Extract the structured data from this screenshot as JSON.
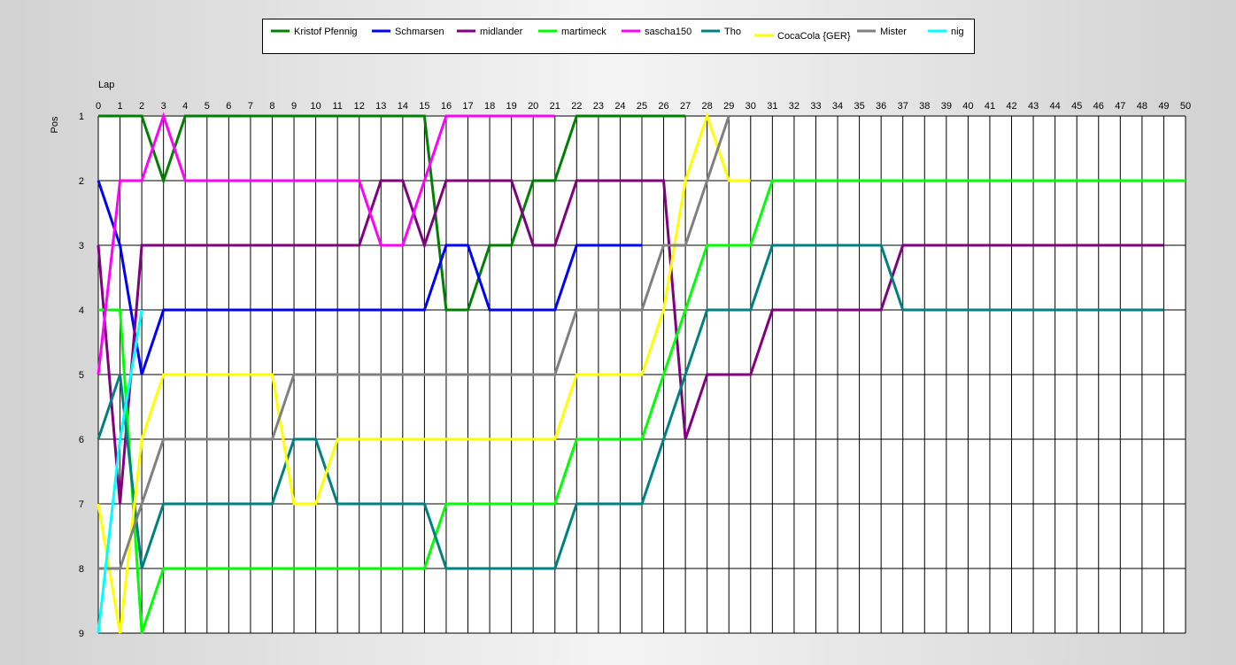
{
  "chart_data": {
    "type": "line",
    "title": "",
    "xlabel": "Lap",
    "ylabel": "Pos",
    "x": [
      0,
      1,
      2,
      3,
      4,
      5,
      6,
      7,
      8,
      9,
      10,
      11,
      12,
      13,
      14,
      15,
      16,
      17,
      18,
      19,
      20,
      21,
      22,
      23,
      24,
      25,
      26,
      27,
      28,
      29,
      30,
      31,
      32,
      33,
      34,
      35,
      36,
      37,
      38,
      39,
      40,
      41,
      42,
      43,
      44,
      45,
      46,
      47,
      48,
      49,
      50
    ],
    "y_ticks": [
      1,
      2,
      3,
      4,
      5,
      6,
      7,
      8,
      9
    ],
    "xlim": [
      0,
      50
    ],
    "ylim": [
      1,
      9
    ],
    "y_inverted": true,
    "grid": true,
    "legend_position": "top-center",
    "series": [
      {
        "name": "Kristof Pfennig",
        "color": "#008000",
        "values": [
          1,
          1,
          1,
          2,
          1,
          1,
          1,
          1,
          1,
          1,
          1,
          1,
          1,
          1,
          1,
          1,
          4,
          4,
          3,
          3,
          2,
          2,
          1,
          1,
          1,
          1,
          1,
          1
        ]
      },
      {
        "name": "Schmarsen",
        "color": "#0000ff",
        "values": [
          2,
          3,
          5,
          4,
          4,
          4,
          4,
          4,
          4,
          4,
          4,
          4,
          4,
          4,
          4,
          4,
          3,
          3,
          4,
          4,
          4,
          4,
          3,
          3,
          3,
          3
        ]
      },
      {
        "name": "midlander",
        "color": "#800080",
        "values": [
          3,
          7,
          3,
          3,
          3,
          3,
          3,
          3,
          3,
          3,
          3,
          3,
          3,
          2,
          2,
          3,
          2,
          2,
          2,
          2,
          3,
          3,
          2,
          2,
          2,
          2,
          2,
          6,
          5,
          5,
          5,
          4,
          4,
          4,
          4,
          4,
          4,
          3,
          3,
          3,
          3,
          3,
          3,
          3,
          3,
          3,
          3,
          3,
          3,
          3
        ]
      },
      {
        "name": "martimeck",
        "color": "#00ff00",
        "values": [
          4,
          4,
          9,
          8,
          8,
          8,
          8,
          8,
          8,
          8,
          8,
          8,
          8,
          8,
          8,
          8,
          7,
          7,
          7,
          7,
          7,
          7,
          6,
          6,
          6,
          6,
          5,
          4,
          3,
          3,
          3,
          2,
          2,
          2,
          2,
          2,
          2,
          2,
          2,
          2,
          2,
          2,
          2,
          2,
          2,
          2,
          2,
          2,
          2,
          2,
          2
        ]
      },
      {
        "name": "sascha150",
        "color": "#ff00ff",
        "values": [
          5,
          2,
          2,
          1,
          2,
          2,
          2,
          2,
          2,
          2,
          2,
          2,
          2,
          3,
          3,
          2,
          1,
          1,
          1,
          1,
          1,
          1
        ]
      },
      {
        "name": "Tho",
        "color": "#008080",
        "values": [
          6,
          5,
          8,
          7,
          7,
          7,
          7,
          7,
          7,
          6,
          6,
          7,
          7,
          7,
          7,
          7,
          8,
          8,
          8,
          8,
          8,
          8,
          7,
          7,
          7,
          7,
          6,
          5,
          4,
          4,
          4,
          3,
          3,
          3,
          3,
          3,
          3,
          4,
          4,
          4,
          4,
          4,
          4,
          4,
          4,
          4,
          4,
          4,
          4,
          4
        ]
      },
      {
        "name": "CocaCola {GER}",
        "color": "#ffff00",
        "values": [
          7,
          9,
          6,
          5,
          5,
          5,
          5,
          5,
          5,
          7,
          7,
          6,
          6,
          6,
          6,
          6,
          6,
          6,
          6,
          6,
          6,
          6,
          5,
          5,
          5,
          5,
          4,
          2,
          1,
          2,
          2
        ]
      },
      {
        "name": "Mister",
        "color": "#808080",
        "values": [
          8,
          8,
          7,
          6,
          6,
          6,
          6,
          6,
          6,
          5,
          5,
          5,
          5,
          5,
          5,
          5,
          5,
          5,
          5,
          5,
          5,
          5,
          4,
          4,
          4,
          4,
          3,
          3,
          2,
          1
        ]
      },
      {
        "name": "nig",
        "color": "#00ffff",
        "values": [
          9,
          6,
          4
        ]
      }
    ]
  }
}
